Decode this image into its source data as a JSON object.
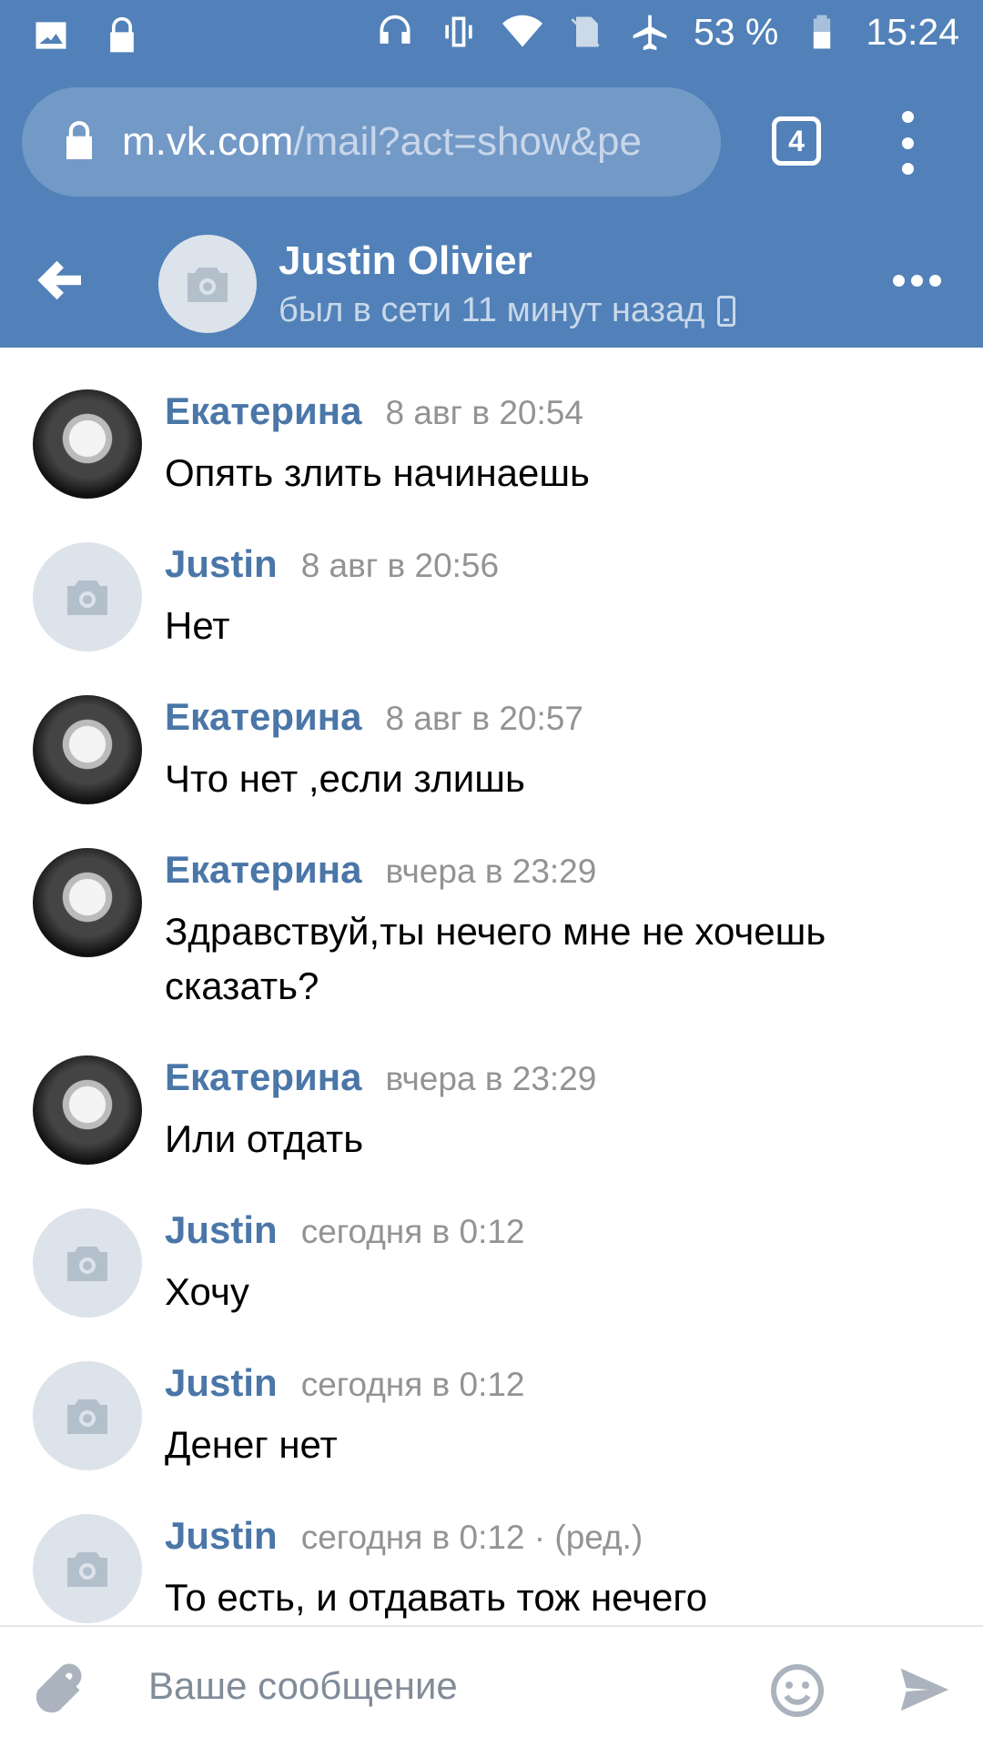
{
  "status_bar": {
    "battery": "53 %",
    "time": "15:24",
    "icons": [
      "image-icon",
      "lock-icon",
      "headphones-icon",
      "vibrate-icon",
      "wifi-icon",
      "no-sim-icon",
      "airplane-icon",
      "battery-icon"
    ]
  },
  "browser": {
    "url_host": "m.vk.com",
    "url_path": "/mail?act=show&pe",
    "tab_count": "4"
  },
  "chat_header": {
    "name": "Justin Olivier",
    "status": "был в сети 11 минут назад"
  },
  "messages": [
    {
      "author": "Екатерина",
      "time": "8 авг в 20:54",
      "text": "Опять злить начинаешь",
      "avatar": "photo"
    },
    {
      "author": "Justin",
      "time": "8 авг в 20:56",
      "text": "Нет",
      "avatar": "camera"
    },
    {
      "author": "Екатерина",
      "time": "8 авг в 20:57",
      "text": "Что нет ,если злишь",
      "avatar": "photo"
    },
    {
      "author": "Екатерина",
      "time": "вчера в 23:29",
      "text": "Здравствуй,ты нечего мне не хочешь сказать?",
      "avatar": "photo"
    },
    {
      "author": "Екатерина",
      "time": "вчера в 23:29",
      "text": "Или отдать",
      "avatar": "photo"
    },
    {
      "author": "Justin",
      "time": "сегодня в 0:12",
      "text": "Хочу",
      "avatar": "camera"
    },
    {
      "author": "Justin",
      "time": "сегодня в 0:12",
      "text": "Денег нет",
      "avatar": "camera"
    },
    {
      "author": "Justin",
      "time": "сегодня в 0:12 · (ред.)",
      "text": "То есть, и отдавать тож нечего",
      "avatar": "camera"
    }
  ],
  "composer": {
    "placeholder": "Ваше сообщение"
  },
  "colors": {
    "accent": "#5181b8",
    "author": "#4a76a8",
    "meta": "#939393"
  }
}
